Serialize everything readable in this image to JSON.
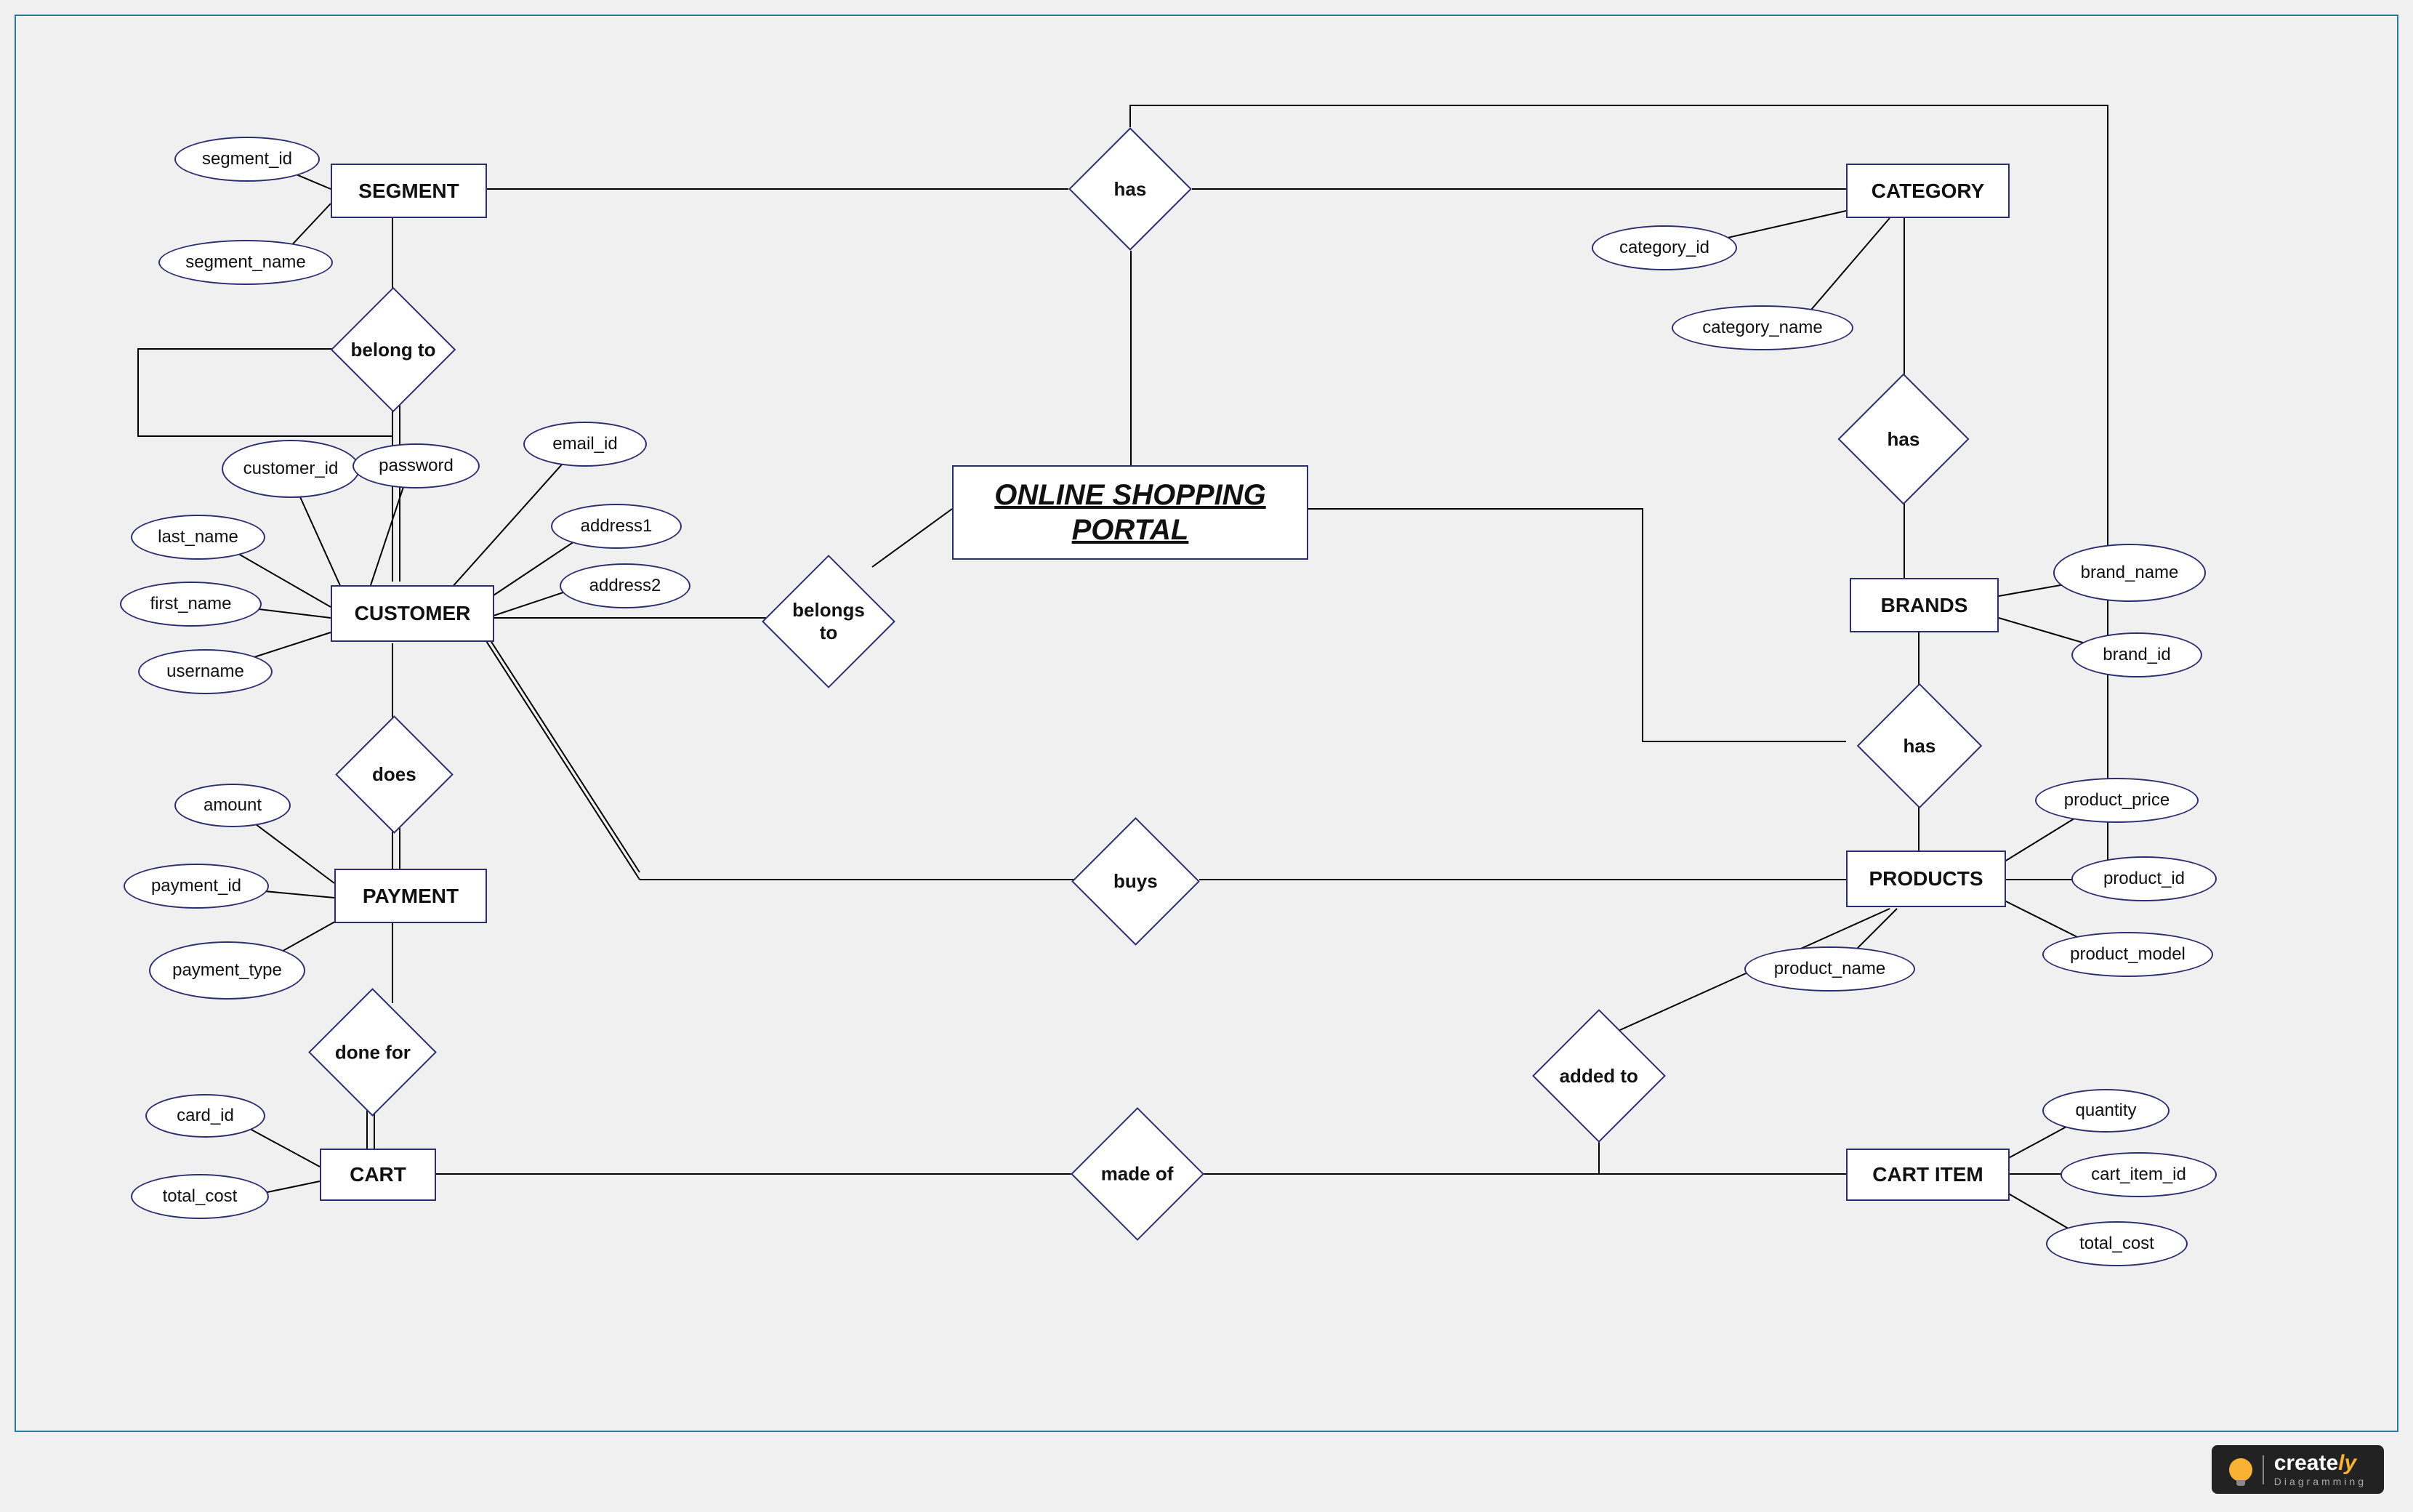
{
  "title": "ONLINE SHOPPING PORTAL",
  "entities": {
    "segment": "SEGMENT",
    "category": "CATEGORY",
    "customer": "CUSTOMER",
    "brands": "BRANDS",
    "payment": "PAYMENT",
    "products": "PRODUCTS",
    "cart": "CART",
    "cart_item": "CART ITEM"
  },
  "relationships": {
    "has_top": "has",
    "belong_to": "belong to",
    "has_cat_brand": "has",
    "belongs_to": "belongs to",
    "does": "does",
    "has_brand_prod": "has",
    "buys": "buys",
    "done_for": "done for",
    "added_to": "added to",
    "made_of": "made of"
  },
  "attributes": {
    "segment_id": "segment_id",
    "segment_name": "segment_name",
    "category_id": "category_id",
    "category_name": "category_name",
    "customer_id": "customer_id",
    "password": "password",
    "email_id": "email_id",
    "last_name": "last_name",
    "first_name": "first_name",
    "username": "username",
    "address1": "address1",
    "address2": "address2",
    "brand_name": "brand_name",
    "brand_id": "brand_id",
    "amount": "amount",
    "payment_id": "payment_id",
    "payment_type": "payment_type",
    "product_price": "product_price",
    "product_id": "product_id",
    "product_model": "product_model",
    "product_name": "product_name",
    "card_id": "card_id",
    "total_cost_cart": "total_cost",
    "quantity": "quantity",
    "cart_item_id": "cart_item_id",
    "total_cost_item": "total_cost"
  },
  "logo": {
    "brand": "create",
    "brand_suffix": "ly",
    "sub": "Diagramming"
  }
}
